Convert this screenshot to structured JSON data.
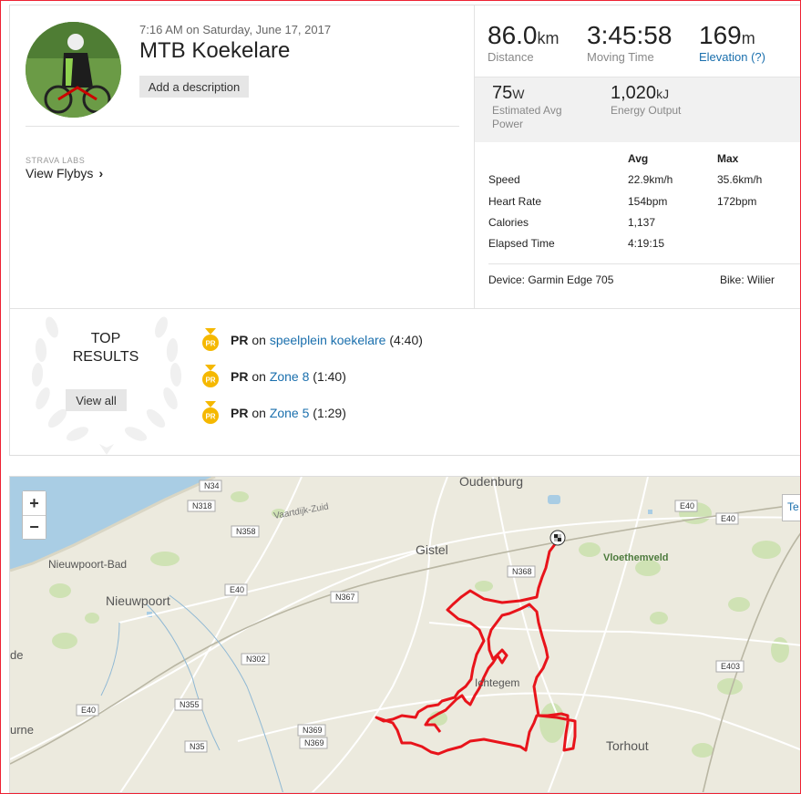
{
  "activity": {
    "datetime": "7:16 AM on Saturday, June 17, 2017",
    "title": "MTB Koekelare",
    "add_description": "Add a description"
  },
  "labs": {
    "label": "STRAVA LABS",
    "link": "View Flybys"
  },
  "stats": {
    "distance": {
      "value": "86.0",
      "unit": "km",
      "label": "Distance"
    },
    "moving_time": {
      "value": "3:45:58",
      "label": "Moving Time"
    },
    "elevation": {
      "value": "169",
      "unit": "m",
      "label": "Elevation (?)"
    },
    "power": {
      "value": "75",
      "unit": "W",
      "label_line1": "Estimated Avg",
      "label_line2": "Power"
    },
    "energy": {
      "value": "1,020",
      "unit": "kJ",
      "label": "Energy Output"
    }
  },
  "table": {
    "headers": {
      "avg": "Avg",
      "max": "Max"
    },
    "rows": [
      {
        "label": "Speed",
        "avg": "22.9km/h",
        "max": "35.6km/h"
      },
      {
        "label": "Heart Rate",
        "avg": "154bpm",
        "max": "172bpm"
      },
      {
        "label": "Calories",
        "avg": "1,137",
        "max": ""
      },
      {
        "label": "Elapsed Time",
        "avg": "4:19:15",
        "max": ""
      }
    ],
    "device": "Device: Garmin Edge 705",
    "bike": "Bike: Wilier"
  },
  "top_results": {
    "title_line1": "TOP",
    "title_line2": "RESULTS",
    "view_all": "View all",
    "items": [
      {
        "badge": "PR",
        "on": "on",
        "segment": "speelplein koekelare",
        "time": "(4:40)"
      },
      {
        "badge": "PR",
        "on": "on",
        "segment": "Zone 8",
        "time": "(1:40)"
      },
      {
        "badge": "PR",
        "on": "on",
        "segment": "Zone 5",
        "time": "(1:29)"
      }
    ]
  },
  "map": {
    "zoom_in": "+",
    "zoom_out": "−",
    "side_tab": "Te",
    "places": {
      "oudenburg": "Oudenburg",
      "gistel": "Gistel",
      "vloethemveld": "Vloethemveld",
      "nieuwpoort_bad": "Nieuwpoort-Bad",
      "nieuwpoort": "Nieuwpoort",
      "ichtegem": "Ichtegem",
      "torhout": "Torhout",
      "vaartdijk": "Vaartdijk-Zuid",
      "urne": "urne",
      "de": "de"
    },
    "roads": {
      "n34": "N34",
      "n318": "N318",
      "n358": "N358",
      "e40a": "E40",
      "e40b": "E40",
      "e40c": "E40",
      "e40d": "E40",
      "n368": "N368",
      "n367": "N367",
      "n302": "N302",
      "n355": "N355",
      "n35": "N35",
      "n369a": "N369",
      "n369b": "N369",
      "e403": "E403"
    },
    "route_color": "#e8141b",
    "sea_color": "#a9cde4"
  }
}
